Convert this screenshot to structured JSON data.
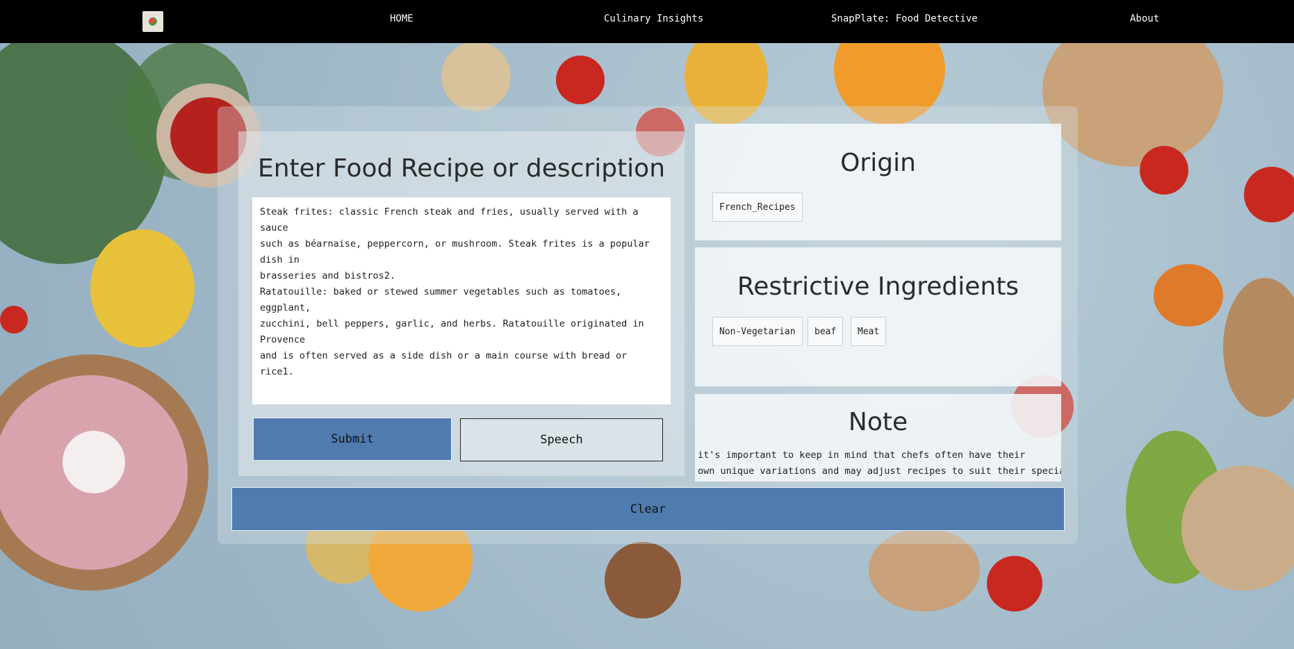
{
  "nav": {
    "logo_icon": "app-logo-icon",
    "items": [
      {
        "label": "HOME"
      },
      {
        "label": "Culinary Insights"
      },
      {
        "label": "SnapPlate: Food Detective"
      },
      {
        "label": "About"
      }
    ]
  },
  "input_panel": {
    "title": "Enter Food Recipe or description",
    "recipe_text": "Steak frites: classic French steak and fries, usually served with a sauce\nsuch as béarnaise, peppercorn, or mushroom. Steak frites is a popular dish in\nbrasseries and bistros2.\nRatatouille: baked or stewed summer vegetables such as tomatoes, eggplant,\nzucchini, bell peppers, garlic, and herbs. Ratatouille originated in Provence\nand is often served as a side dish or a main course with bread or rice1.",
    "submit_label": "Submit",
    "speech_label": "Speech"
  },
  "origin": {
    "title": "Origin",
    "tags": [
      "French_Recipes"
    ]
  },
  "restrictive": {
    "title": "Restrictive Ingredients",
    "tags": [
      "Non-Vegetarian",
      "beaf",
      "Meat"
    ]
  },
  "note": {
    "title": "Note",
    "text": "it's important to keep in mind that chefs often have their\nown unique variations and may adjust recipes to suit their specialty."
  },
  "clear_label": "Clear",
  "colors": {
    "nav_bg": "#000000",
    "button_blue": "#4f7baf"
  }
}
